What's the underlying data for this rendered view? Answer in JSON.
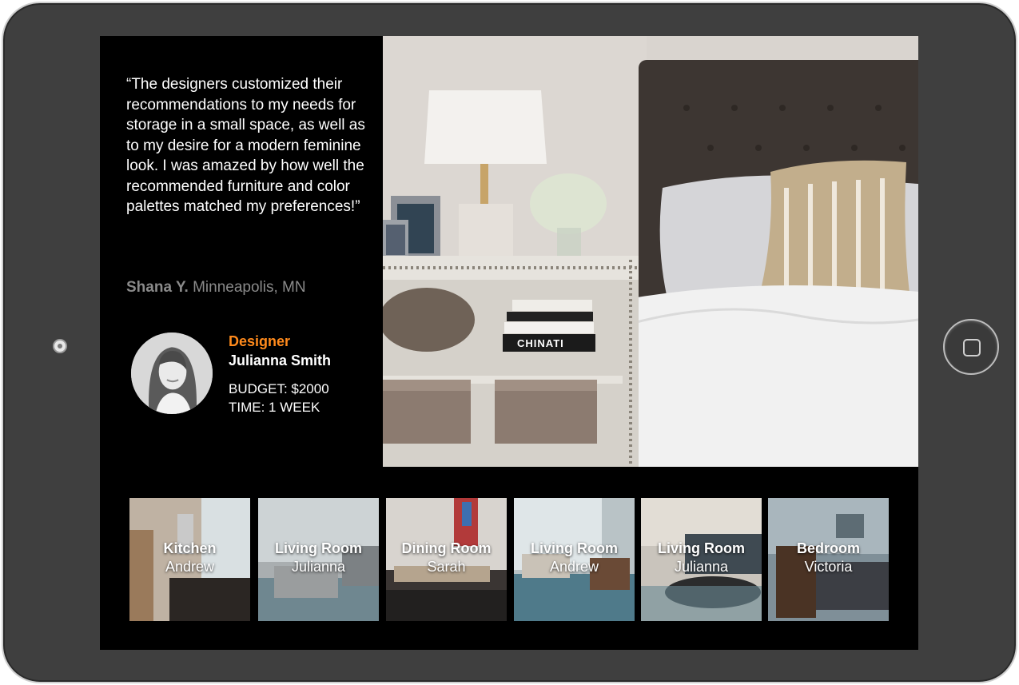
{
  "testimonial": {
    "quote": "“The designers customized their recommendations to my needs for storage in a small space, as well as to my desire for a modern feminine look. I was amazed by how well the recommended furniture and color palettes matched my preferences!”",
    "author_name": "Shana Y.",
    "author_location": "Minneapolis, MN"
  },
  "designer": {
    "role": "Designer",
    "name": "Julianna Smith",
    "budget": "BUDGET: $2000",
    "time": "TIME: 1 WEEK"
  },
  "hero_image": {
    "book_spine": "CHINATI"
  },
  "thumbnails": [
    {
      "room": "Kitchen",
      "designer": "Andrew"
    },
    {
      "room": "Living Room",
      "designer": "Julianna"
    },
    {
      "room": "Dining Room",
      "designer": "Sarah"
    },
    {
      "room": "Living Room",
      "designer": "Andrew"
    },
    {
      "room": "Living Room",
      "designer": "Julianna"
    },
    {
      "room": "Bedroom",
      "designer": "Victoria"
    }
  ],
  "colors": {
    "accent": "#ff8a1c",
    "screen_bg": "#000000",
    "bezel": "#3f3f3f"
  }
}
